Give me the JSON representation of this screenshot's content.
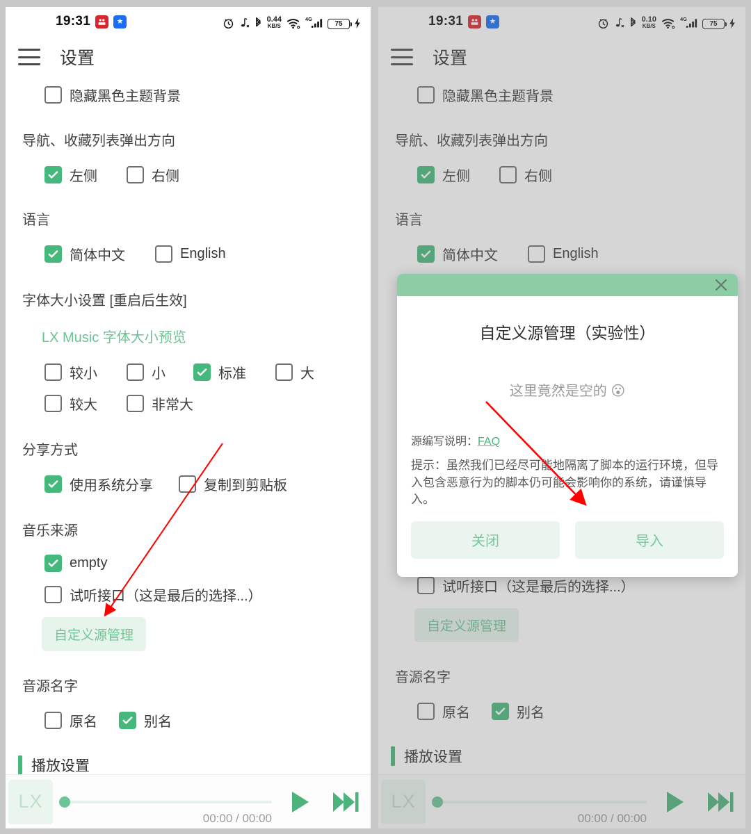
{
  "colors": {
    "accent": "#45b97c",
    "accent_light": "#8ccda6",
    "pill_bg": "#e7f4ec",
    "annotation": "#ff0000",
    "panel_bg": "#ffffff",
    "page_bg": "#c8c8c8"
  },
  "left": {
    "status": {
      "time": "19:31",
      "network_speed_value": "0.44",
      "network_speed_unit": "KB/S",
      "signal_gen": "4G",
      "battery": "75",
      "icons": [
        "alarm-icon",
        "music-mute-icon",
        "bluetooth-icon",
        "network-speed-icon",
        "wifi-icon",
        "signal-bars-icon",
        "battery-icon",
        "charging-bolt-icon"
      ]
    },
    "appbar": {
      "title": "设置",
      "menu_icon": "hamburger-icon"
    },
    "sections": [
      {
        "kind": "checkrow",
        "items": [
          {
            "label": "隐藏黑色主题背景",
            "checked": false
          }
        ]
      },
      {
        "kind": "group",
        "title": "导航、收藏列表弹出方向",
        "items": [
          {
            "label": "左侧",
            "checked": true
          },
          {
            "label": "右侧",
            "checked": false
          }
        ]
      },
      {
        "kind": "group",
        "title": "语言",
        "items": [
          {
            "label": "简体中文",
            "checked": true
          },
          {
            "label": "English",
            "checked": false
          }
        ]
      },
      {
        "kind": "fontsize",
        "title": "字体大小设置 [重启后生效]",
        "preview": "LX Music 字体大小预览",
        "row1": [
          {
            "label": "较小",
            "checked": false
          },
          {
            "label": "小",
            "checked": false
          },
          {
            "label": "标准",
            "checked": true
          },
          {
            "label": "大",
            "checked": false
          }
        ],
        "row2": [
          {
            "label": "较大",
            "checked": false
          },
          {
            "label": "非常大",
            "checked": false
          }
        ]
      },
      {
        "kind": "group",
        "title": "分享方式",
        "items": [
          {
            "label": "使用系统分享",
            "checked": true
          },
          {
            "label": "复制到剪贴板",
            "checked": false
          }
        ]
      },
      {
        "kind": "source",
        "title": "音乐来源",
        "items": [
          {
            "label": "empty",
            "checked": true
          },
          {
            "label": "试听接口（这是最后的选择...）",
            "checked": false
          }
        ],
        "button": "自定义源管理"
      },
      {
        "kind": "group",
        "title": "音源名字",
        "items": [
          {
            "label": "原名",
            "checked": false
          },
          {
            "label": "别名",
            "checked": true
          }
        ]
      }
    ],
    "block_title": "播放设置",
    "player": {
      "art_label": "LX",
      "time": "00:00 / 00:00",
      "play_icon": "play-icon",
      "next_icon": "next-track-icon"
    }
  },
  "right": {
    "status": {
      "time": "19:31",
      "network_speed_value": "0.10",
      "network_speed_unit": "KB/S",
      "signal_gen": "4G",
      "battery": "75"
    },
    "appbar": {
      "title": "设置",
      "menu_icon": "hamburger-icon"
    },
    "sections": [
      {
        "kind": "checkrow",
        "items": [
          {
            "label": "隐藏黑色主题背景",
            "checked": false
          }
        ]
      },
      {
        "kind": "group",
        "title": "导航、收藏列表弹出方向",
        "items": [
          {
            "label": "左侧",
            "checked": true
          },
          {
            "label": "右侧",
            "checked": false
          }
        ]
      },
      {
        "kind": "group",
        "title": "语言",
        "items": [
          {
            "label": "简体中文",
            "checked": true
          },
          {
            "label": "English",
            "checked": false
          }
        ]
      }
    ],
    "below_items": [
      {
        "label": "试听接口（这是最后的选择...）",
        "checked": false
      }
    ],
    "below_button": "自定义源管理",
    "below_group_title": "音源名字",
    "below_group_items": [
      {
        "label": "原名",
        "checked": false
      },
      {
        "label": "别名",
        "checked": true
      }
    ],
    "block_title": "播放设置",
    "player": {
      "art_label": "LX",
      "time": "00:00 / 00:00"
    },
    "dialog": {
      "close_icon": "close-icon",
      "title": "自定义源管理（实验性）",
      "empty_text": "这里竟然是空的 😮",
      "faq_label": "源编写说明：",
      "faq_link": "FAQ",
      "note": "提示：虽然我们已经尽可能地隔离了脚本的运行环境，但导入包含恶意行为的脚本仍可能会影响你的系统，请谨慎导入。",
      "close_button": "关闭",
      "import_button": "导入"
    }
  }
}
